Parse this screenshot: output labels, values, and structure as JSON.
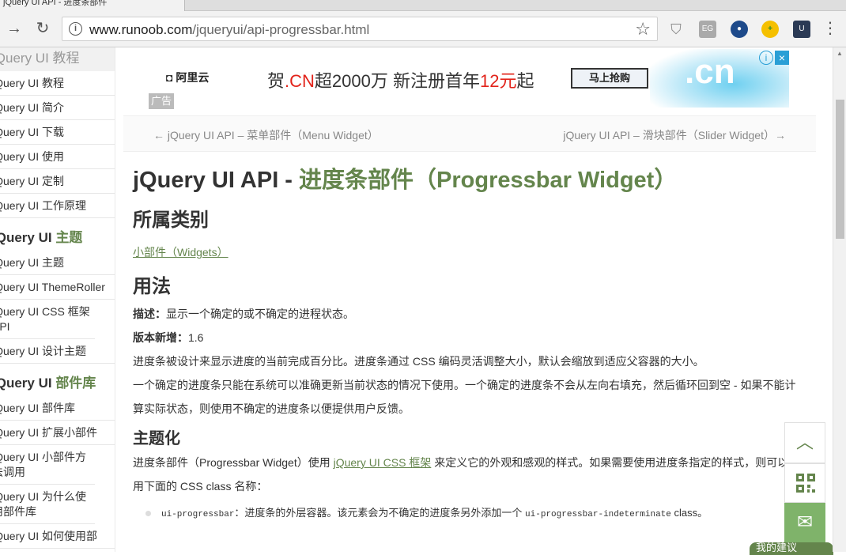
{
  "browser": {
    "tab_title": "jQuery UI API - 进度条部件",
    "url_host": "www.runoob.com",
    "url_path": "/jqueryui/api-progressbar.html"
  },
  "sidebar": {
    "header": "jQuery UI 教程",
    "items_a": [
      "jQuery UI 教程",
      "jQuery UI 简介",
      "jQuery UI 下载",
      "jQuery UI 使用",
      "jQuery UI 定制",
      "jQuery UI 工作原理"
    ],
    "section_theme_a": "jQuery UI ",
    "section_theme_b": "主题",
    "items_b": [
      "jQuery UI 主题",
      "jQuery UI ThemeRoller",
      "jQuery UI CSS 框架 API",
      "jQuery UI 设计主题"
    ],
    "section_widgets_a": "jQuery UI ",
    "section_widgets_b": "部件库",
    "items_c": [
      "jQuery UI 部件库",
      "jQuery UI 扩展小部件",
      "jQuery UI 小部件方法调用",
      "jQuery UI 为什么使用部件库",
      "jQuery UI 如何使用部"
    ]
  },
  "ad": {
    "logo": "阿里云",
    "slogan_a": "贺",
    "slogan_b": ".CN",
    "slogan_c": "超2000万  新注册首年",
    "slogan_d": "12元",
    "slogan_e": "起",
    "button": "马上抢购",
    "domain": ".cn",
    "tag": "广告"
  },
  "pager": {
    "prev": "← jQuery UI API – 菜单部件（Menu Widget）",
    "next": "jQuery UI API – 滑块部件（Slider Widget）→"
  },
  "article": {
    "title_a": "jQuery UI API - ",
    "title_b": "进度条部件（Progressbar Widget）",
    "category_heading": "所属类别",
    "category_link": "小部件（Widgets）",
    "usage_heading": "用法",
    "desc_label": "描述：",
    "desc_text": "显示一个确定的或不确定的进程状态。",
    "version_label": "版本新增：",
    "version_text": "1.6",
    "para1": "进度条被设计来显示进度的当前完成百分比。进度条通过 CSS 编码灵活调整大小，默认会缩放到适应父容器的大小。",
    "para2": "一个确定的进度条只能在系统可以准确更新当前状态的情况下使用。一个确定的进度条不会从左向右填充，然后循环回到空 - 如果不能计算实际状态，则使用不确定的进度条以便提供用户反馈。",
    "theming_heading": "主题化",
    "theming_a": "进度条部件（Progressbar Widget）使用 ",
    "theming_link": "jQuery UI CSS 框架",
    "theming_b": " 来定义它的外观和感观的样式。如果需要使用进度条指定的样式，则可以使用下面的 CSS class 名称：",
    "class_code": "ui-progressbar",
    "class_text": "：进度条的外层容器。该元素会为不确定的进度条另外添加一个 ",
    "class_code2": "ui-progressbar-indeterminate",
    "class_text2": " class。"
  },
  "floating": {
    "feedback": "我的建议"
  }
}
